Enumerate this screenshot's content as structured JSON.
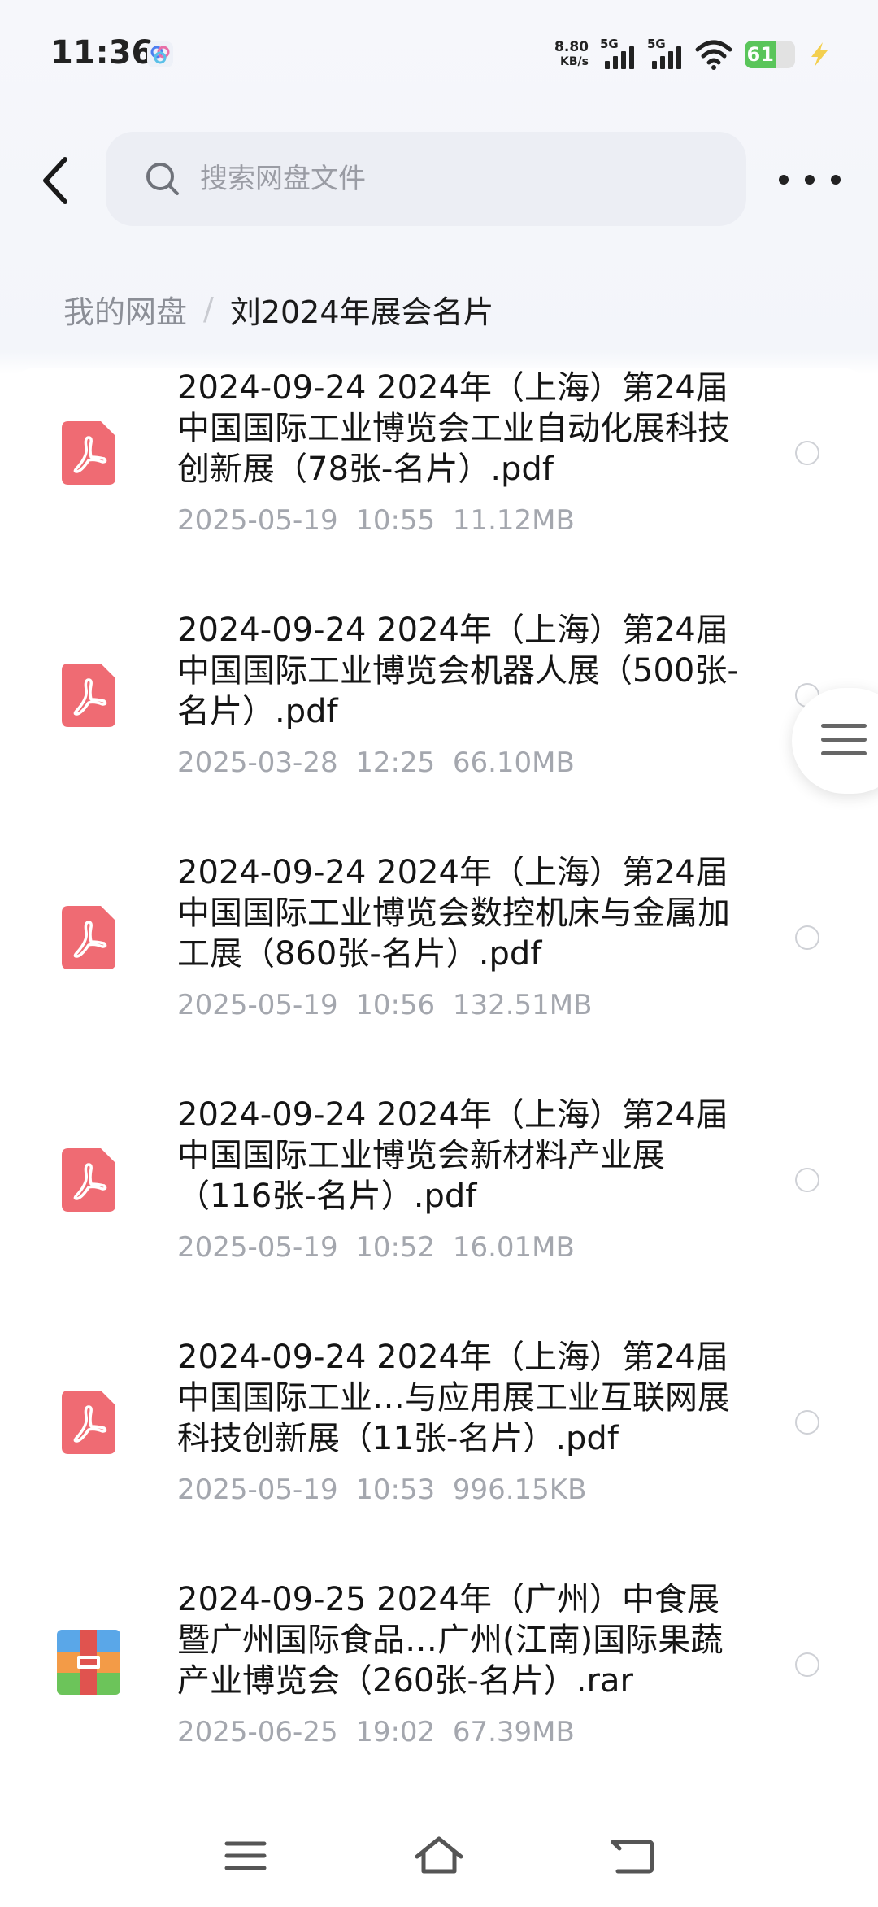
{
  "status_bar": {
    "time": "11:36",
    "net_speed_value": "8.80",
    "net_speed_unit": "KB/s",
    "sim1": "5G",
    "sim2": "5G",
    "battery_level": "61",
    "battery_color": "#5ac55a"
  },
  "header": {
    "search_placeholder": "搜索网盘文件"
  },
  "breadcrumb": {
    "root": "我的网盘",
    "separator": "/",
    "current": "刘2024年展会名片"
  },
  "files": [
    {
      "name": "2024-09-24  2024年（上海）第24届中国国际工业博览会工业自动化展科技创新展（78张-名片）.pdf",
      "date": "2025-05-19  10:55",
      "size": "11.12MB",
      "icon": "pdf-icon"
    },
    {
      "name": "2024-09-24  2024年（上海）第24届中国国际工业博览会机器人展（500张-名片）.pdf",
      "date": "2025-03-28  12:25",
      "size": "66.10MB",
      "icon": "pdf-icon"
    },
    {
      "name": "2024-09-24  2024年（上海）第24届中国国际工业博览会数控机床与金属加工展（860张-名片）.pdf",
      "date": "2025-05-19  10:56",
      "size": "132.51MB",
      "icon": "pdf-icon"
    },
    {
      "name": "2024-09-24  2024年（上海）第24届中国国际工业博览会新材料产业展（116张-名片）.pdf",
      "date": "2025-05-19  10:52",
      "size": "16.01MB",
      "icon": "pdf-icon"
    },
    {
      "name": "2024-09-24  2024年（上海）第24届中国国际工业…与应用展工业互联网展科技创新展（11张-名片）.pdf",
      "date": "2025-05-19  10:53",
      "size": "996.15KB",
      "icon": "pdf-icon"
    },
    {
      "name": "2024-09-25  2024年（广州）中食展暨广州国际食品…广州(江南)国际果蔬产业博览会（260张-名片）.rar",
      "date": "2025-06-25  19:02",
      "size": "67.39MB",
      "icon": "rar-archive-icon"
    }
  ],
  "colors": {
    "pdf_icon": "#ef6b73",
    "accent_text": "#151515",
    "meta_text": "#a4a7ae"
  }
}
